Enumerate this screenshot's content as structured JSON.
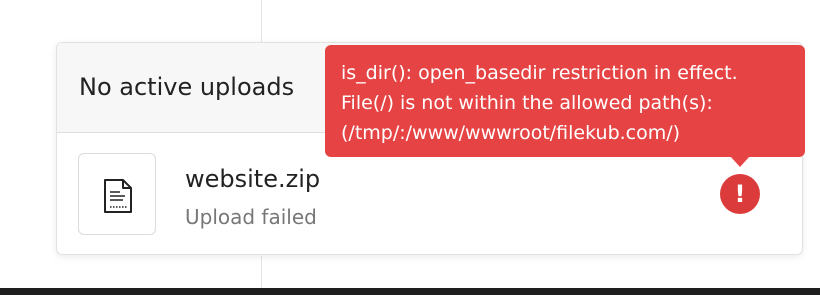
{
  "upload_panel": {
    "title": "No active uploads",
    "file": {
      "name": "website.zip",
      "status": "Upload failed",
      "thumbnail_icon": "document-icon"
    },
    "error_icon": {
      "icon": "exclamation-icon",
      "glyph": "!"
    }
  },
  "tooltip": {
    "lines": [
      "is_dir(): open_basedir restriction in effect.",
      "File(/) is not within the allowed path(s):",
      "(/tmp/:/www/wwwroot/filekub.com/)"
    ]
  },
  "colors": {
    "error": "#e64444",
    "error_icon": "#dc3b3b",
    "header_bg": "#f7f7f7"
  }
}
